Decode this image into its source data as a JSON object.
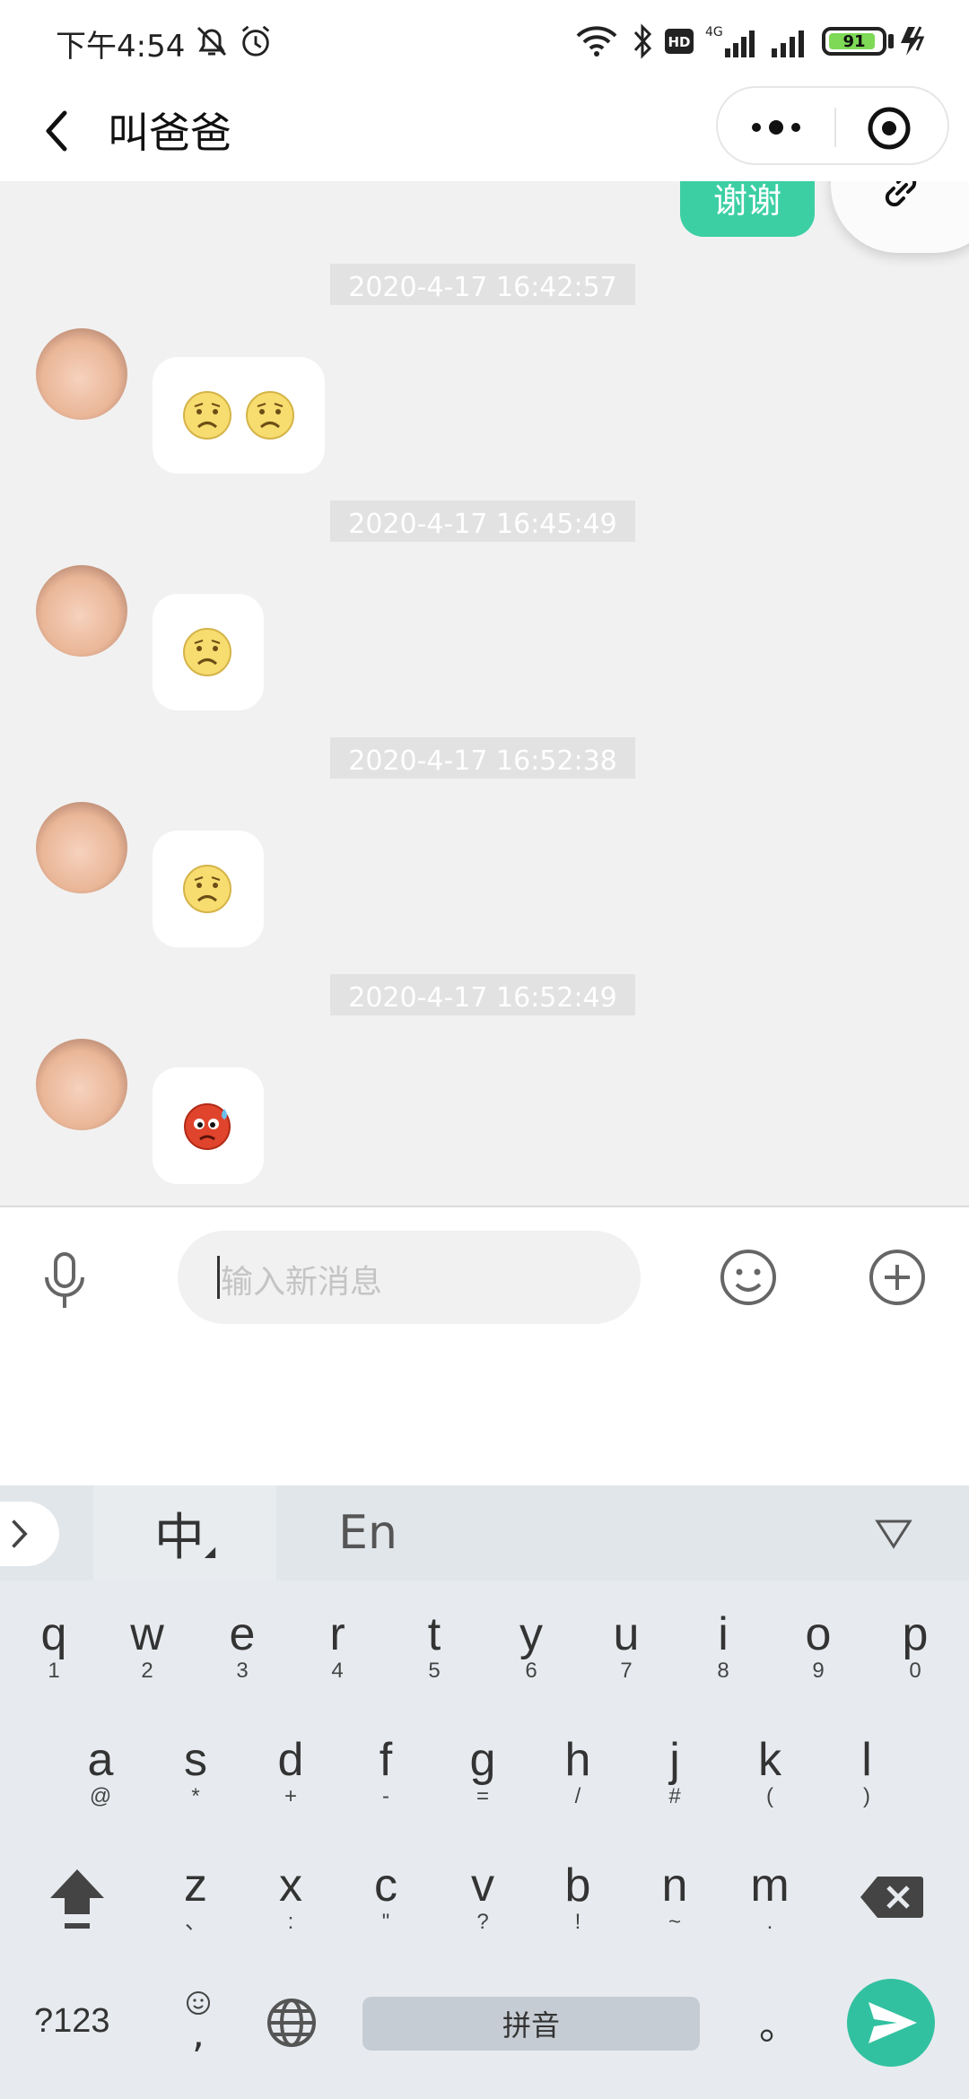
{
  "status_bar": {
    "time": "下午4:54",
    "battery_level": "91",
    "battery_fraction": 0.91,
    "network_label": "4G",
    "hd_label": "HD"
  },
  "title_bar": {
    "title": "叫爸爸"
  },
  "chat": {
    "sent_message": "谢谢",
    "messages": [
      {
        "timestamp": "2020-4-17 16:42:57",
        "emojis": [
          "frown",
          "frown"
        ]
      },
      {
        "timestamp": "2020-4-17 16:45:49",
        "emojis": [
          "frown"
        ]
      },
      {
        "timestamp": "2020-4-17 16:52:38",
        "emojis": [
          "frown"
        ]
      },
      {
        "timestamp": "2020-4-17 16:52:49",
        "emojis": [
          "sweat-red"
        ]
      }
    ]
  },
  "input_bar": {
    "placeholder": "输入新消息"
  },
  "keyboard": {
    "lang_zh": "中",
    "lang_en": "En",
    "row1": [
      {
        "main": "q",
        "sub": "1"
      },
      {
        "main": "w",
        "sub": "2"
      },
      {
        "main": "e",
        "sub": "3"
      },
      {
        "main": "r",
        "sub": "4"
      },
      {
        "main": "t",
        "sub": "5"
      },
      {
        "main": "y",
        "sub": "6"
      },
      {
        "main": "u",
        "sub": "7"
      },
      {
        "main": "i",
        "sub": "8"
      },
      {
        "main": "o",
        "sub": "9"
      },
      {
        "main": "p",
        "sub": "0"
      }
    ],
    "row2": [
      {
        "main": "a",
        "sub": "@"
      },
      {
        "main": "s",
        "sub": "*"
      },
      {
        "main": "d",
        "sub": "+"
      },
      {
        "main": "f",
        "sub": "-"
      },
      {
        "main": "g",
        "sub": "="
      },
      {
        "main": "h",
        "sub": "/"
      },
      {
        "main": "j",
        "sub": "#"
      },
      {
        "main": "k",
        "sub": "("
      },
      {
        "main": "l",
        "sub": ")"
      }
    ],
    "row3": [
      {
        "main": "z",
        "sub": "、"
      },
      {
        "main": "x",
        "sub": ":"
      },
      {
        "main": "c",
        "sub": "\""
      },
      {
        "main": "v",
        "sub": "?"
      },
      {
        "main": "b",
        "sub": "!"
      },
      {
        "main": "n",
        "sub": "~"
      },
      {
        "main": "m",
        "sub": "."
      }
    ],
    "num_label": "?123",
    "comma_label": ",",
    "space_label": "拼音",
    "period_label": "。"
  },
  "colors": {
    "accent": "#3ccfa4",
    "send_button": "#32c1a0",
    "chat_background": "#f1f1f1"
  }
}
